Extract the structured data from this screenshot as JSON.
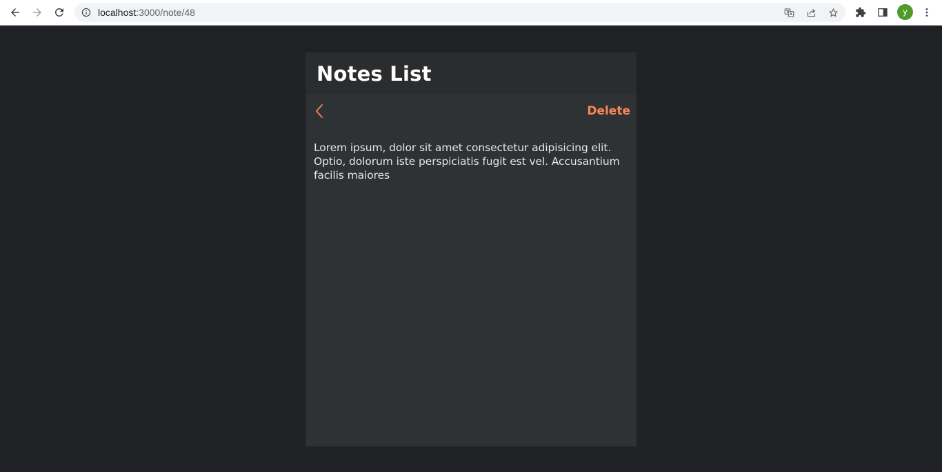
{
  "browser": {
    "url_host": "localhost",
    "url_rest": ":3000/note/48",
    "profile_initial": "y",
    "icons": {
      "back": "arrow-left-icon",
      "forward": "arrow-right-icon",
      "reload": "reload-icon",
      "site_info": "info-icon",
      "translate": "translate-icon",
      "share": "share-icon",
      "bookmark": "star-icon",
      "extensions": "puzzle-icon",
      "side_panel": "side-panel-icon",
      "menu": "kebab-menu-icon"
    }
  },
  "app": {
    "title": "Notes List",
    "back_icon": "chevron-left-icon",
    "delete_label": "Delete",
    "note_text": "Lorem ipsum, dolor sit amet consectetur adipisicing elit. Optio, dolorum iste perspiciatis fugit est vel. Accusantium facilis maiores"
  },
  "colors": {
    "page_background": "#202124",
    "card_background": "#2e3235",
    "header_background": "#2b2c2e",
    "accent": "#f68657",
    "title_text": "#ffffff",
    "body_text": "#e6e6e6",
    "avatar": "#4e9a2a"
  }
}
